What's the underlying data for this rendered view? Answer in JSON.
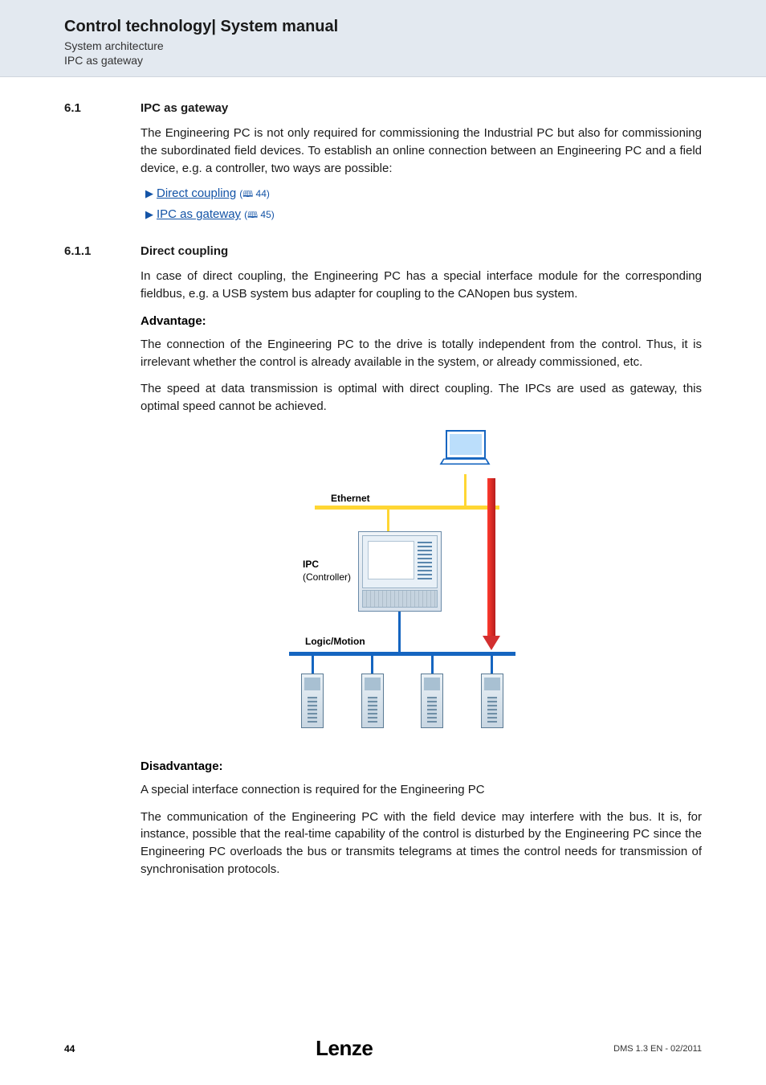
{
  "header": {
    "doc_title": "Control technology| System manual",
    "breadcrumb1": "System architecture",
    "breadcrumb2": "IPC as gateway"
  },
  "sec61": {
    "num": "6.1",
    "title": "IPC as gateway",
    "intro": "The Engineering PC is not only required for commissioning the Industrial PC but also for commissioning the subordinated field devices. To establish an online connection between an Engineering PC and a field device, e.g. a controller, two ways are possible:",
    "link1_text": "Direct coupling",
    "link1_ref": "44",
    "link2_text": "IPC as gateway",
    "link2_ref": "45"
  },
  "sec611": {
    "num": "6.1.1",
    "title": "Direct coupling",
    "p1": "In case of direct coupling, the Engineering PC has a special interface module for the corresponding fieldbus, e.g. a USB system bus adapter for coupling to the CANopen bus system.",
    "adv_head": "Advantage:",
    "adv_p1": "The connection of the Engineering PC to the drive is totally independent from the control. Thus, it is irrelevant whether the control is already available in the system, or already commissioned, etc.",
    "adv_p2": "The speed at data transmission is optimal with direct coupling. The IPCs are used as gateway, this optimal speed cannot be achieved.",
    "dis_head": "Disadvantage:",
    "dis_p1": "A special interface connection is required for the Engineering PC",
    "dis_p2": "The communication of the Engineering PC with the field device may interfere with the bus. It is, for instance, possible that the real-time capability of the control is disturbed by the Engineering PC since the Engineering PC overloads the bus or transmits telegrams at times the control needs for transmission of synchronisation protocols."
  },
  "diagram": {
    "ethernet": "Ethernet",
    "ipc": "IPC",
    "controller": "(Controller)",
    "logic_motion": "Logic/Motion"
  },
  "footer": {
    "page": "44",
    "logo": "Lenze",
    "docid": "DMS 1.3 EN - 02/2011"
  }
}
